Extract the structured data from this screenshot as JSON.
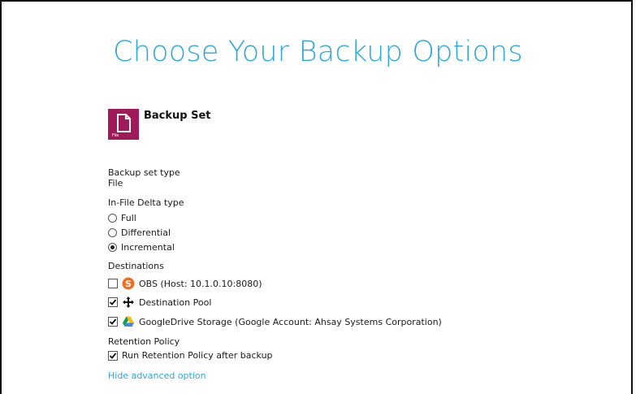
{
  "page": {
    "title": "Choose Your Backup Options"
  },
  "backup_set": {
    "icon_caption": "File",
    "title": "Backup Set"
  },
  "backup_set_type": {
    "label": "Backup set type",
    "value": "File"
  },
  "delta": {
    "label": "In-File Delta type",
    "options": [
      {
        "label": "Full",
        "selected": false
      },
      {
        "label": "Differential",
        "selected": false
      },
      {
        "label": "Incremental",
        "selected": true
      }
    ]
  },
  "destinations": {
    "label": "Destinations",
    "items": [
      {
        "label": "OBS (Host: 10.1.0.10:8080)",
        "checked": false,
        "icon": "obs-icon"
      },
      {
        "label": "Destination Pool",
        "checked": true,
        "icon": "move-arrows-icon"
      },
      {
        "label": "GoogleDrive Storage (Google Account: Ahsay Systems Corporation)",
        "checked": true,
        "icon": "google-drive-icon"
      }
    ]
  },
  "retention": {
    "label": "Retention Policy",
    "option_label": "Run Retention Policy after backup",
    "checked": true
  },
  "advanced": {
    "link_label": "Hide advanced option"
  },
  "colors": {
    "accent": "#2ea7da",
    "backup_icon": "#a01a5a",
    "obs_orange": "#f26f21"
  }
}
